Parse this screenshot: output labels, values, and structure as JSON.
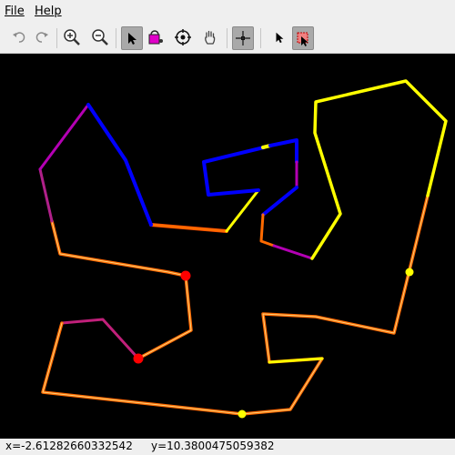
{
  "menu": {
    "file_label": "File",
    "help_label": "Help"
  },
  "toolbar": {
    "tools": [
      "undo-icon",
      "redo-icon",
      "zoom-in-icon",
      "zoom-out-icon",
      "select-arrow-icon",
      "paint-bucket-icon",
      "target-icon",
      "hand-pan-icon",
      "crosshair-icon",
      "pointer-icon",
      "transform-select-icon"
    ],
    "active": [
      "select-arrow-icon",
      "crosshair-icon",
      "transform-select-icon"
    ]
  },
  "canvas": {
    "background": "#000000",
    "colors": {
      "blue": "#0000ff",
      "yellow": "#ffff00",
      "orange": "#ff6a00",
      "magenta": "#a0109a",
      "red_point": "#ff0000",
      "yellow_point": "#ffff00"
    }
  },
  "status": {
    "x_text": "x=-2.61282660332542",
    "y_text": "y=10.3800475059382"
  }
}
